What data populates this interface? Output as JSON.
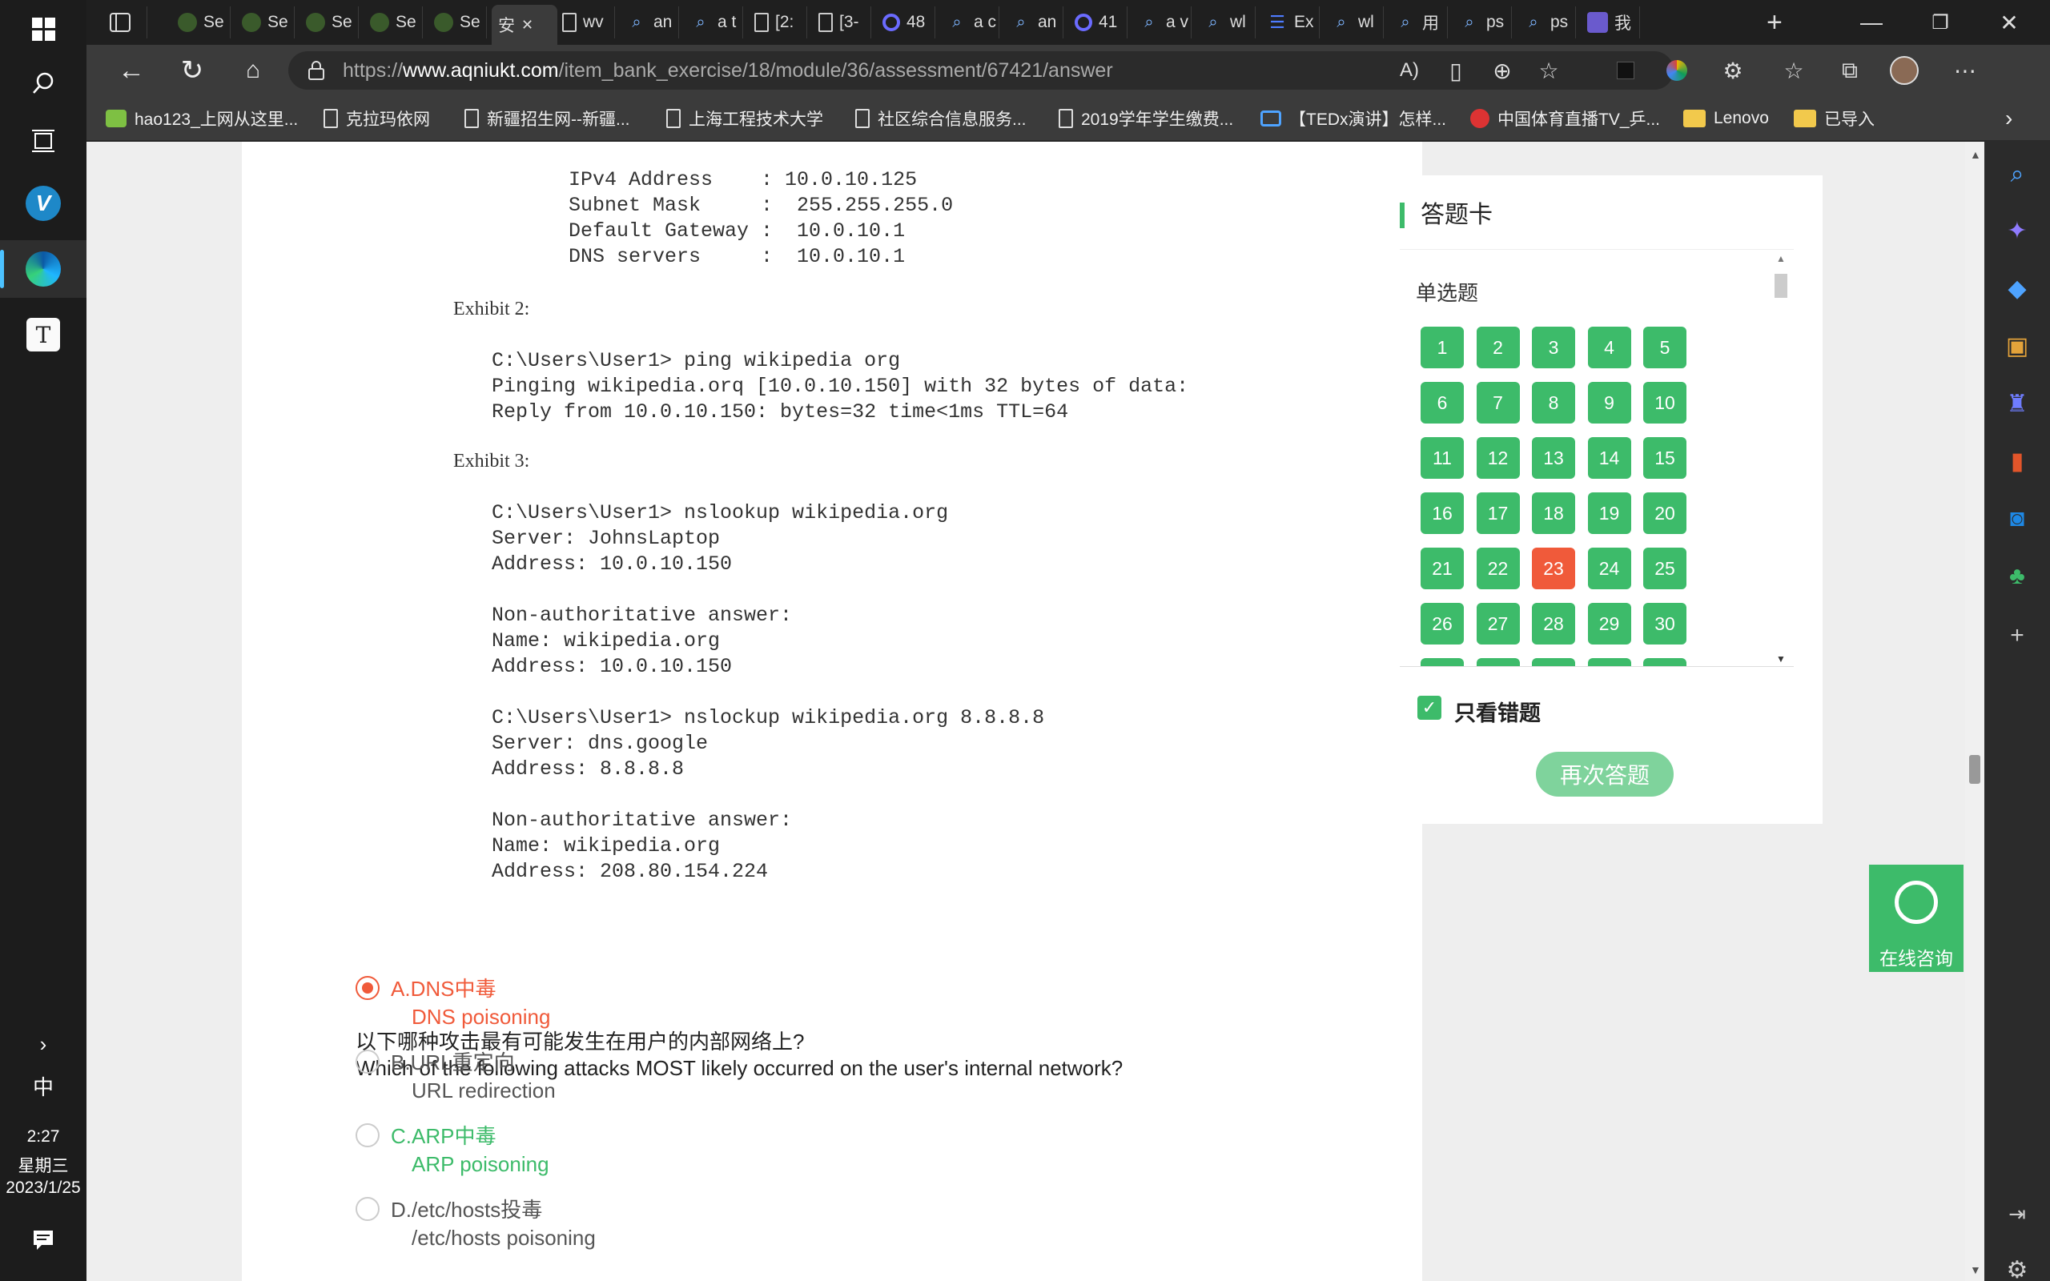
{
  "taskbar": {
    "time": "2:27",
    "weekday": "星期三",
    "date": "2023/1/25",
    "ime": "中"
  },
  "tabs": [
    {
      "icon": "game-icon",
      "label": "Se"
    },
    {
      "icon": "game-icon",
      "label": "Se"
    },
    {
      "icon": "game-icon",
      "label": "Se"
    },
    {
      "icon": "game-icon",
      "label": "Se"
    },
    {
      "icon": "game-icon",
      "label": "Se"
    },
    {
      "icon": "none",
      "label": "安",
      "active": true
    },
    {
      "icon": "doc-icon",
      "label": "wv"
    },
    {
      "icon": "search-icon",
      "label": "an"
    },
    {
      "icon": "search-icon",
      "label": "a t"
    },
    {
      "icon": "doc-icon",
      "label": "[2:"
    },
    {
      "icon": "doc-icon",
      "label": "[3-"
    },
    {
      "icon": "ring-icon",
      "label": "48"
    },
    {
      "icon": "search-icon",
      "label": "a c"
    },
    {
      "icon": "search-icon",
      "label": "an"
    },
    {
      "icon": "ring-icon",
      "label": "41"
    },
    {
      "icon": "search-icon",
      "label": "a v"
    },
    {
      "icon": "search-icon",
      "label": "wl"
    },
    {
      "icon": "list-icon",
      "label": "Ex"
    },
    {
      "icon": "search-icon",
      "label": "wl"
    },
    {
      "icon": "search-icon",
      "label": "用"
    },
    {
      "icon": "search-icon",
      "label": "ps"
    },
    {
      "icon": "search-icon",
      "label": "ps"
    },
    {
      "icon": "paw-icon",
      "label": "我"
    }
  ],
  "url": {
    "prefix": "https://",
    "domain": "www.aqniukt.com",
    "path": "/item_bank_exercise/18/module/36/assessment/67421/answer"
  },
  "bookmarks": [
    "hao123_上网从这里...",
    "克拉玛依网",
    "新疆招生网--新疆...",
    "上海工程技术大学",
    "社区综合信息服务...",
    "2019学年学生缴费...",
    "【TEDx演讲】怎样...",
    "中国体育直播TV_乒...",
    "Lenovo",
    "已导入"
  ],
  "exhibits": {
    "ipconfig": "IPv4 Address    : 10.0.10.125\nSubnet Mask     :  255.255.255.0\nDefault Gateway :  10.0.10.1\nDNS servers     :  10.0.10.1",
    "exhibit2_title": "Exhibit 2:",
    "exhibit2_body": "C:\\Users\\User1> ping wikipedia org\nPinging wikipedia.orq [10.0.10.150] with 32 bytes of data:\nReply from 10.0.10.150: bytes=32 time<1ms TTL=64",
    "exhibit3_title": "Exhibit 3:",
    "exhibit3_body": "C:\\Users\\User1> nslookup wikipedia.org\nServer: JohnsLaptop\nAddress: 10.0.10.150\n\nNon-authoritative answer:\nName: wikipedia.org\nAddress: 10.0.10.150\n\nC:\\Users\\User1> nslockup wikipedia.org 8.8.8.8\nServer: dns.google\nAddress: 8.8.8.8\n\nNon-authoritative answer:\nName: wikipedia.org\nAddress: 208.80.154.224"
  },
  "question": {
    "cn": "以下哪种攻击最有可能发生在用户的内部网络上?",
    "en": "Which of the following attacks MOST likely occurred on the user's internal network?"
  },
  "options": [
    {
      "label": "A.DNS中毒",
      "sub": "DNS poisoning",
      "state": "selected-wrong"
    },
    {
      "label": "B.URL重定向",
      "sub": "URL redirection",
      "state": "none"
    },
    {
      "label": "C.ARP中毒",
      "sub": "ARP poisoning",
      "state": "correct"
    },
    {
      "label": "D./etc/hosts投毒",
      "sub": "/etc/hosts poisoning",
      "state": "none"
    }
  ],
  "answer_card": {
    "title": "答题卡",
    "section": "单选题",
    "questions": [
      "1",
      "2",
      "3",
      "4",
      "5",
      "6",
      "7",
      "8",
      "9",
      "10",
      "11",
      "12",
      "13",
      "14",
      "15",
      "16",
      "17",
      "18",
      "19",
      "20",
      "21",
      "22",
      "23",
      "24",
      "25",
      "26",
      "27",
      "28",
      "29",
      "30"
    ],
    "wrong": [
      "23"
    ],
    "only_wrong_label": "只看错题",
    "only_wrong_checked": true,
    "retry_label": "再次答题"
  },
  "consult": {
    "label": "在线咨询"
  },
  "colors": {
    "accent_green": "#3dbb6a",
    "wrong_red": "#f05a3a"
  }
}
